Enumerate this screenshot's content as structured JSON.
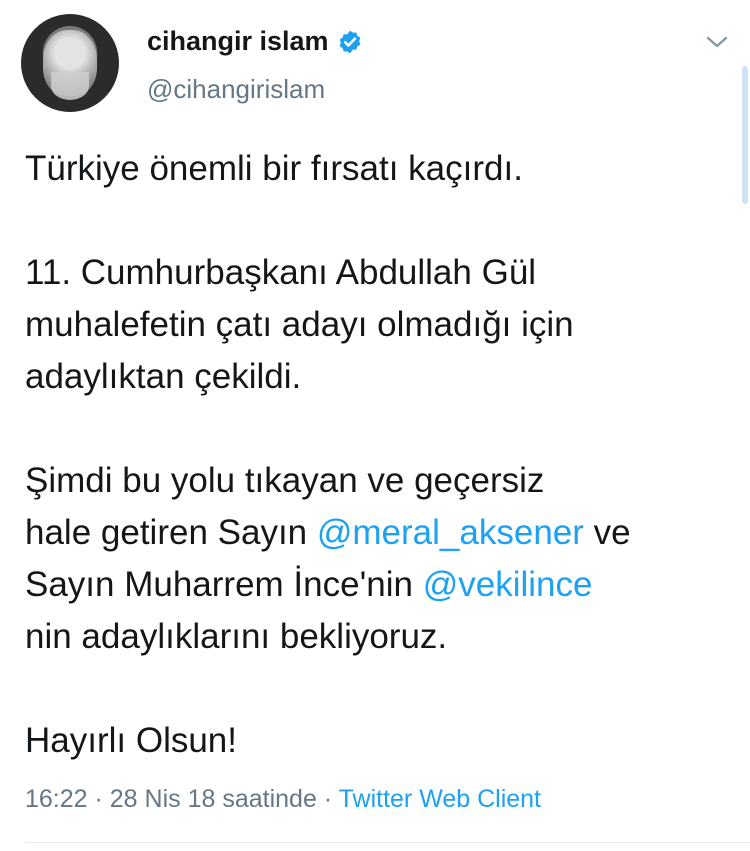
{
  "user": {
    "name": "cihangir islam",
    "handle": "@cihangirislam",
    "verified": true
  },
  "tweet": {
    "line1": "Türkiye önemli bir fırsatı kaçırdı.",
    "line2": "11. Cumhurbaşkanı Abdullah Gül",
    "line3": "muhalefetin çatı adayı olmadığı için",
    "line4": "adaylıktan çekildi.",
    "line5": "Şimdi bu yolu tıkayan ve geçersiz",
    "line6_prefix": "hale getiren Sayın ",
    "mention1": "@meral_aksener",
    "line6_suffix": " ve",
    "line7_prefix": "Sayın Muharrem İnce'nin ",
    "mention2": "@vekilince",
    "line8": "nin adaylıklarını bekliyoruz.",
    "line9": "Hayırlı Olsun!"
  },
  "meta": {
    "timestamp": "16:22 · 28 Nis 18 saatinde · ",
    "client": "Twitter Web Client"
  },
  "colors": {
    "link": "#1da1f2",
    "secondary": "#657786",
    "verified": "#1da1f2"
  },
  "icons": {
    "verified": "verified-badge-icon",
    "menu": "chevron-down-icon"
  }
}
